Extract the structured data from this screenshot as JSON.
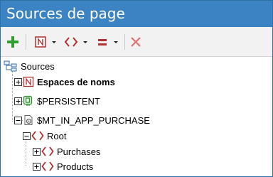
{
  "window": {
    "title": "Sources de page"
  },
  "toolbar": {
    "items": [
      "add-icon",
      "namespace-icon",
      "tag-icon",
      "equals-icon",
      "delete-icon"
    ],
    "colors": {
      "add": "#2e9e2e",
      "namespace": "#b03030",
      "tag": "#b03030",
      "delete": "#d84444"
    }
  },
  "tree": {
    "root": {
      "label": "Sources"
    },
    "namespaces": {
      "label": "Espaces de noms"
    },
    "persistent": {
      "label": "$PERSISTENT"
    },
    "mt": {
      "label": "$MT_IN_APP_PURCHASE"
    },
    "root_node": {
      "label": "Root"
    },
    "purchases": {
      "label": "Purchases"
    },
    "products": {
      "label": "Products"
    }
  }
}
